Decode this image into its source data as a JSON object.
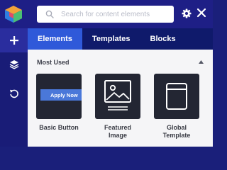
{
  "topbar": {
    "logo": "app-logo-icon",
    "search_placeholder": "Search for content elements",
    "search_value": "",
    "icons": {
      "search": "search-icon",
      "settings": "gear-icon",
      "close": "close-icon"
    }
  },
  "rail": {
    "items": [
      {
        "name": "add",
        "icon": "plus-icon",
        "active": true
      },
      {
        "name": "layers",
        "icon": "layers-icon",
        "active": false
      },
      {
        "name": "history",
        "icon": "undo-icon",
        "active": false
      }
    ]
  },
  "tabs": [
    {
      "label": "Elements",
      "active": true
    },
    {
      "label": "Templates",
      "active": false
    },
    {
      "label": "Blocks",
      "active": false
    }
  ],
  "section": {
    "title": "Most Used",
    "collapse_icon": "caret-up-icon"
  },
  "elements": [
    {
      "label": "Basic Button",
      "preview_button_text": "Apply Now",
      "icon": "button-preview"
    },
    {
      "label": "Featured\nImage",
      "line1": "Featured",
      "line2": "Image",
      "icon": "image-icon"
    },
    {
      "label": "Global\nTemplate",
      "line1": "Global",
      "line2": "Template",
      "icon": "template-icon"
    }
  ],
  "colors": {
    "topbar": "#1e1f86",
    "rail": "#191c77",
    "tabs_bg": "#0f1a6b",
    "active_tab": "#2f59d9",
    "panel": "#f5f5f7",
    "card": "#232633",
    "preview_button": "#4a78d9"
  }
}
